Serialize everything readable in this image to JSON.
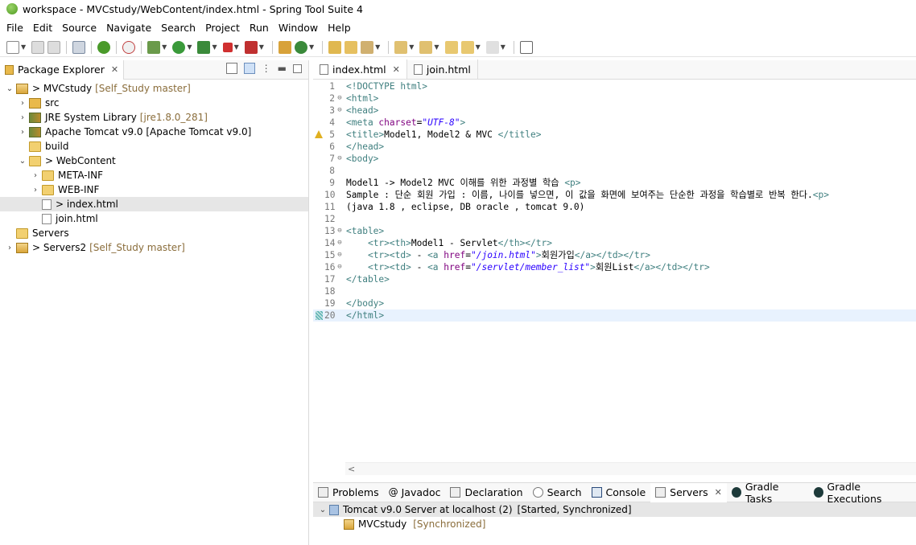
{
  "window": {
    "title": "workspace - MVCstudy/WebContent/index.html - Spring Tool Suite 4"
  },
  "menu": [
    "File",
    "Edit",
    "Source",
    "Navigate",
    "Search",
    "Project",
    "Run",
    "Window",
    "Help"
  ],
  "explorer": {
    "tab_label": "Package Explorer",
    "rows": [
      {
        "label": "> MVCstudy",
        "decor": "[Self_Study master]",
        "indent": 0,
        "twisty": "⌄",
        "icon": "project-icon"
      },
      {
        "label": "src",
        "decor": "",
        "indent": 1,
        "twisty": "›",
        "icon": "package-icon"
      },
      {
        "label": "JRE System Library",
        "decor": "[jre1.8.0_281]",
        "indent": 1,
        "twisty": "›",
        "icon": "library-icon"
      },
      {
        "label": "Apache Tomcat v9.0 [Apache Tomcat v9.0]",
        "decor": "",
        "indent": 1,
        "twisty": "›",
        "icon": "library-icon"
      },
      {
        "label": "build",
        "decor": "",
        "indent": 1,
        "twisty": "",
        "icon": "folder-icon"
      },
      {
        "label": "> WebContent",
        "decor": "",
        "indent": 1,
        "twisty": "⌄",
        "icon": "folder-icon"
      },
      {
        "label": "META-INF",
        "decor": "",
        "indent": 2,
        "twisty": "›",
        "icon": "folder-icon"
      },
      {
        "label": "WEB-INF",
        "decor": "",
        "indent": 2,
        "twisty": "›",
        "icon": "folder-icon"
      },
      {
        "label": "> index.html",
        "decor": "",
        "indent": 2,
        "twisty": "",
        "icon": "html-file-icon",
        "selected": true
      },
      {
        "label": "join.html",
        "decor": "",
        "indent": 2,
        "twisty": "",
        "icon": "html-file-icon"
      },
      {
        "label": "Servers",
        "decor": "",
        "indent": 0,
        "twisty": "",
        "icon": "folder-icon"
      },
      {
        "label": "> Servers2",
        "decor": "[Self_Study master]",
        "indent": 0,
        "twisty": "›",
        "icon": "project-icon"
      }
    ]
  },
  "editor": {
    "tabs": [
      {
        "label": "index.html",
        "active": true
      },
      {
        "label": "join.html",
        "active": false
      }
    ],
    "lines": [
      {
        "n": "1",
        "fold": "",
        "parts": [
          [
            "t",
            "<!DOCTYPE html>"
          ]
        ]
      },
      {
        "n": "2",
        "fold": "⊖",
        "parts": [
          [
            "t",
            "<html>"
          ]
        ]
      },
      {
        "n": "3",
        "fold": "⊖",
        "parts": [
          [
            "t",
            "<head>"
          ]
        ]
      },
      {
        "n": "4",
        "fold": "",
        "parts": [
          [
            "t",
            "<meta "
          ],
          [
            "a",
            "charset"
          ],
          [
            "p",
            "="
          ],
          [
            "v",
            "\"UTF-8\""
          ],
          [
            "t",
            ">"
          ]
        ]
      },
      {
        "n": "5",
        "fold": "",
        "warn": true,
        "parts": [
          [
            "t",
            "<title>"
          ],
          [
            "p",
            "Model1, Model2 & MVC "
          ],
          [
            "t",
            "</title>"
          ]
        ]
      },
      {
        "n": "6",
        "fold": "",
        "parts": [
          [
            "t",
            "</head>"
          ]
        ]
      },
      {
        "n": "7",
        "fold": "⊖",
        "parts": [
          [
            "t",
            "<body>"
          ]
        ]
      },
      {
        "n": "8",
        "fold": "",
        "parts": []
      },
      {
        "n": "9",
        "fold": "",
        "parts": [
          [
            "p",
            "Model1 -> Model2 MVC 이해를 위한 과정별 학습 "
          ],
          [
            "t",
            "<p>"
          ]
        ]
      },
      {
        "n": "10",
        "fold": "",
        "parts": [
          [
            "p",
            "Sample : 단순 회원 가입 : 이름, 나이를 넣으면, 이 값을 화면에 보여주는 단순한 과정을 학습별로 반복 한다."
          ],
          [
            "t",
            "<p>"
          ]
        ]
      },
      {
        "n": "11",
        "fold": "",
        "parts": [
          [
            "p",
            "(java 1.8 , eclipse, DB oracle , tomcat 9.0)"
          ]
        ]
      },
      {
        "n": "12",
        "fold": "",
        "parts": []
      },
      {
        "n": "13",
        "fold": "⊖",
        "parts": [
          [
            "t",
            "<table>"
          ]
        ]
      },
      {
        "n": "14",
        "fold": "⊖",
        "parts": [
          [
            "p",
            "    "
          ],
          [
            "t",
            "<tr><th>"
          ],
          [
            "p",
            "Model1 - Servlet"
          ],
          [
            "t",
            "</th></tr>"
          ]
        ]
      },
      {
        "n": "15",
        "fold": "⊖",
        "parts": [
          [
            "p",
            "    "
          ],
          [
            "t",
            "<tr><td>"
          ],
          [
            "p",
            " - "
          ],
          [
            "t",
            "<a "
          ],
          [
            "a",
            "href"
          ],
          [
            "p",
            "="
          ],
          [
            "v",
            "\"/join.html\""
          ],
          [
            "t",
            ">"
          ],
          [
            "p",
            "회원가입"
          ],
          [
            "t",
            "</a></td></tr>"
          ]
        ]
      },
      {
        "n": "16",
        "fold": "⊖",
        "parts": [
          [
            "p",
            "    "
          ],
          [
            "t",
            "<tr><td>"
          ],
          [
            "p",
            " - "
          ],
          [
            "t",
            "<a "
          ],
          [
            "a",
            "href"
          ],
          [
            "p",
            "="
          ],
          [
            "v",
            "\"/servlet/member_list\""
          ],
          [
            "t",
            ">"
          ],
          [
            "p",
            "회원List"
          ],
          [
            "t",
            "</a></td></tr>"
          ]
        ]
      },
      {
        "n": "17",
        "fold": "",
        "parts": [
          [
            "t",
            "</table>"
          ]
        ]
      },
      {
        "n": "18",
        "fold": "",
        "parts": []
      },
      {
        "n": "19",
        "fold": "",
        "parts": [
          [
            "t",
            "</body>"
          ]
        ]
      },
      {
        "n": "20",
        "fold": "",
        "current": true,
        "parts": [
          [
            "t",
            "</html>"
          ]
        ]
      }
    ]
  },
  "bottom": {
    "tabs": [
      {
        "label": "Problems",
        "icon": "problems-icon"
      },
      {
        "label": "Javadoc",
        "icon": "javadoc-icon"
      },
      {
        "label": "Declaration",
        "icon": "declaration-icon"
      },
      {
        "label": "Search",
        "icon": "search-icon"
      },
      {
        "label": "Console",
        "icon": "console-icon"
      },
      {
        "label": "Servers",
        "icon": "servers-icon",
        "active": true
      },
      {
        "label": "Gradle Tasks",
        "icon": "gradle-icon"
      },
      {
        "label": "Gradle Executions",
        "icon": "gradle-icon"
      }
    ],
    "server": {
      "name": "Tomcat v9.0 Server at localhost (2)",
      "state": "[Started, Synchronized]",
      "module": "MVCstudy",
      "module_state": "[Synchronized]"
    }
  },
  "colors": {
    "tag": "#3f7f7f",
    "attr": "#7f007f",
    "value": "#2a00ff",
    "decor": "#8a6d3b",
    "current_line": "#e8f2fe"
  }
}
